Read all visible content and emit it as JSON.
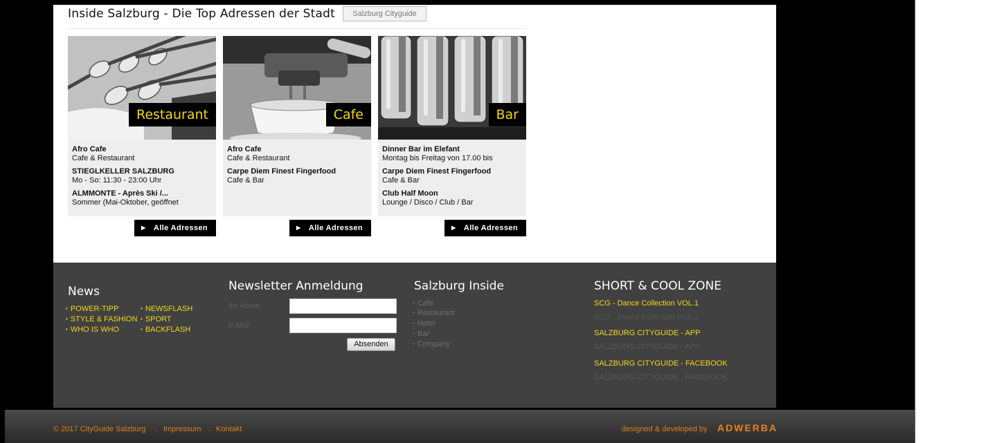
{
  "header": {
    "title": "Inside Salzburg - Die Top Adressen der Stadt",
    "tag_button": "Salzburg Cityguide"
  },
  "cards": [
    {
      "label": "Restaurant",
      "image_icon": "cutlery-image",
      "entries": [
        {
          "name": "Afro Cafe",
          "sub": "Cafe & Restaurant"
        },
        {
          "name": "STIEGLKELLER SALZBURG",
          "sub": "Mo - So: 11:30 - 23:00 Uhr"
        },
        {
          "name": "ALMMONTE - Après Ski /...",
          "sub": "Sommer (Mai-Oktober, geöffnet"
        }
      ],
      "button": "Alle Adressen"
    },
    {
      "label": "Cafe",
      "image_icon": "espresso-machine-image",
      "entries": [
        {
          "name": "Afro Cafe",
          "sub": "Cafe & Restaurant"
        },
        {
          "name": "Carpe Diem Finest Fingerfood",
          "sub": "Cafe & Bar"
        }
      ],
      "button": "Alle Adressen"
    },
    {
      "label": "Bar",
      "image_icon": "bar-glasses-image",
      "entries": [
        {
          "name": "Dinner Bar im Elefant",
          "sub": "Montag bis Freitag von 17.00 bis"
        },
        {
          "name": "Carpe Diem Finest Fingerfood",
          "sub": "Cafe & Bar"
        },
        {
          "name": "Club Half Moon",
          "sub": "Lounge / Disco / Club / Bar"
        }
      ],
      "button": "Alle Adressen"
    }
  ],
  "footer": {
    "news": {
      "title": "News",
      "links": [
        "POWER-TIPP",
        "NEWSFLASH",
        "STYLE & FASHION",
        "SPORT",
        "WHO IS WHO",
        "BACKFLASH"
      ]
    },
    "newsletter": {
      "title": "Newsletter Anmeldung",
      "name_label": "Ihr Name",
      "email_label": "E-Mail",
      "name_value": "",
      "email_value": "",
      "submit": "Absenden"
    },
    "inside": {
      "title": "Salzburg Inside",
      "links": [
        "Cafe",
        "Restaurant",
        "Hotel",
        "Bar",
        "Company"
      ]
    },
    "cool_zone": {
      "title": "SHORT & COOL ZONE",
      "items": [
        {
          "title": "SCG - Dance Collection VOL.1",
          "sub": "SCG - Dance Collection VOL.1"
        },
        {
          "title": "SALZBURG CITYGUIDE - APP",
          "sub": "SALZBURG CITYGUIDE - APP"
        },
        {
          "title": "SALZBURG CITYGUIDE - FACEBOOK",
          "sub": "SALZBURG CITYGUIDE - FACEBOOK"
        }
      ]
    }
  },
  "bottom": {
    "copyright": "© 2017 CityGuide Salzburg",
    "sep": ".",
    "impressum": "Impressum",
    "kontakt": "Kontakt",
    "credit": "designed & developed by",
    "brand": "ADWERBA"
  },
  "colors": {
    "accent_yellow": "#f2d81a",
    "footer_orange": "#e07d18",
    "footer_bg": "#414141"
  }
}
